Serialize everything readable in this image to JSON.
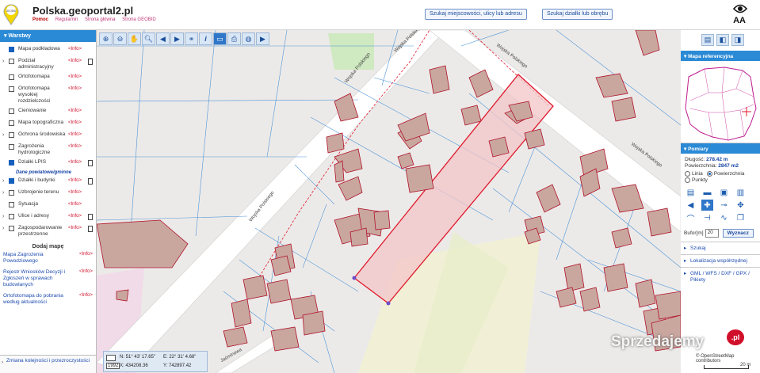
{
  "header": {
    "title": "Polska.geoportal2.pl",
    "logo_text": "GEOBID",
    "nav": [
      "Pomoc",
      "Regulamin",
      "Strona główna",
      "Strona GEOBID"
    ],
    "search_address_btn": "Szukaj miejscowości, ulicy lub adresu",
    "search_parcel_btn": "Szukaj działki lub obrębu",
    "font_size_label": "AA"
  },
  "layers": {
    "title": "Warstwy",
    "items": [
      {
        "label": "Mapa podkładowa",
        "info": "<Info>",
        "checked": true,
        "arrow": false,
        "doc": false
      },
      {
        "label": "Podział administracyjny",
        "info": "<Info>",
        "checked": false,
        "arrow": true,
        "doc": true
      },
      {
        "label": "Ortofotomapa",
        "info": "<Info>",
        "checked": false,
        "arrow": false,
        "doc": false
      },
      {
        "label": "Ortofotomapa wysokiej rozdzielczości",
        "info": "<Info>",
        "checked": false,
        "arrow": false,
        "doc": false
      },
      {
        "label": "Cieniowanie",
        "info": "<Info>",
        "checked": false,
        "arrow": false,
        "doc": false
      },
      {
        "label": "Mapa topograficzna",
        "info": "<Info>",
        "checked": false,
        "arrow": false,
        "doc": false
      },
      {
        "label": "Ochrona środowiska",
        "info": "<Info>",
        "checked": false,
        "arrow": true,
        "doc": false
      },
      {
        "label": "Zagrożenia hydrologiczne",
        "info": "<Info>",
        "checked": false,
        "arrow": false,
        "doc": false
      },
      {
        "label": "Działki LPIS",
        "info": "<Info>",
        "checked": true,
        "arrow": false,
        "doc": true
      }
    ],
    "subheading": "Dane powiatowe/gminne",
    "items2": [
      {
        "label": "Działki i budynki",
        "info": "<Info>",
        "checked": true,
        "arrow": true,
        "doc": true
      },
      {
        "label": "Uzbrojenie terenu",
        "info": "<Info>",
        "checked": false,
        "arrow": true,
        "doc": false
      },
      {
        "label": "Sytuacja",
        "info": "<Info>",
        "checked": false,
        "arrow": false,
        "doc": false
      },
      {
        "label": "Ulice i adresy",
        "info": "<Info>",
        "checked": false,
        "arrow": true,
        "doc": true
      },
      {
        "label": "Zagospodarowanie przestrzenne",
        "info": "<Info>",
        "checked": false,
        "arrow": true,
        "doc": true
      }
    ],
    "add_map_title": "Dodaj mapę",
    "extra_maps": [
      {
        "label": "Mapa Zagrożenia Powodziowego",
        "info": "<Info>"
      },
      {
        "label": "Rejestr Wniosków Decyzji i Zgłoszeń w sprawach budowlanych",
        "info": "<Info>"
      },
      {
        "label": "Ortofotomapa do pobrania według aktualności",
        "info": "<Info>"
      }
    ],
    "order_btn": "Zmiana kolejności i przezroczystości"
  },
  "map": {
    "street_labels": [
      "Wojska Polskiego",
      "Wojska Polskiego",
      "Wojska Polskiego",
      "Wojska Polskiego",
      "Wojska Polskiego",
      "Jaśminowa"
    ],
    "colors": {
      "background": "#eceae8",
      "building": "#c9a79f",
      "building_stroke": "#b0122a",
      "selected_fill": "#f3c5c8",
      "selected_stroke": "#e0182c",
      "parcel": "#4f95d8",
      "road": "#ffffff",
      "green": "#cfe9c0"
    }
  },
  "coords": {
    "year": "1992",
    "n": "N: 51° 43' 17.65\"",
    "e": "E: 22° 31' 4.68\"",
    "x": "X: 434208.36",
    "y": "Y: 742897.42"
  },
  "right_panel": {
    "ref_title": "Mapa referencyjna",
    "measure_title": "Pomiary",
    "length_label": "Długość:",
    "length_value": "278.42 m",
    "area_label": "Powierzchnia:",
    "area_value": "2847 m2",
    "opt_line": "Linia",
    "opt_area": "Powierzchnia",
    "opt_points": "Punkty",
    "buffer_label": "Bufor[m]",
    "buffer_value": "20",
    "search_btn": "Wyznacz",
    "accordion": [
      "Szukaj",
      "Lokalizacja współrzędnej",
      "GML / WFS / DXF / GPX / Pikiety"
    ]
  },
  "footer": {
    "watermark": "Sprzedajemy",
    "watermark_badge": ".pl",
    "attribution": "© OpenStreetMap contributors",
    "scale_label": "20 m"
  }
}
